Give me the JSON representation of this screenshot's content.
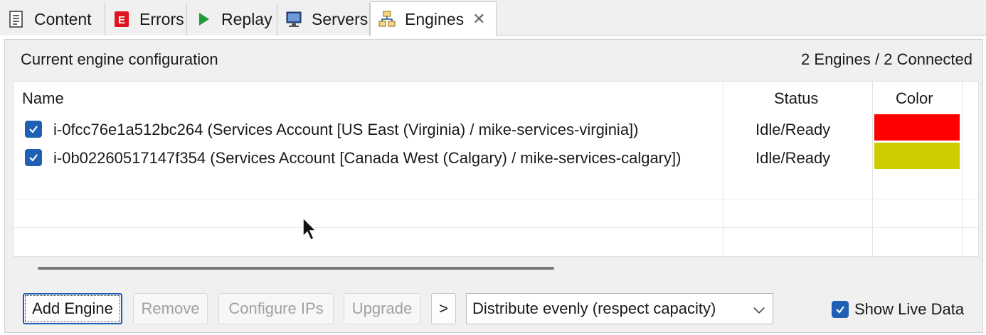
{
  "tabs": [
    {
      "label": "Content",
      "icon": "document-icon"
    },
    {
      "label": "Errors",
      "icon": "error-icon"
    },
    {
      "label": "Replay",
      "icon": "play-icon"
    },
    {
      "label": "Servers",
      "icon": "monitor-icon"
    },
    {
      "label": "Engines",
      "icon": "engines-icon",
      "active": true
    }
  ],
  "panel": {
    "title": "Current engine configuration",
    "summary": "2 Engines / 2 Connected"
  },
  "table": {
    "columns": [
      "Name",
      "Status",
      "Color"
    ],
    "rows": [
      {
        "checked": true,
        "name": "i-0fcc76e1a512bc264 (Services Account [US East (Virginia) / mike-services-virginia])",
        "status": "Idle/Ready",
        "color": "#ff0000"
      },
      {
        "checked": true,
        "name": "i-0b02260517147f354 (Services Account [Canada West (Calgary) / mike-services-calgary])",
        "status": "Idle/Ready",
        "color": "#cccc00"
      }
    ]
  },
  "toolbar": {
    "add_engine": "Add Engine",
    "remove": "Remove",
    "configure_ips": "Configure IPs",
    "upgrade": "Upgrade",
    "more": ">",
    "distribution": "Distribute evenly (respect capacity)",
    "show_live_data": "Show Live Data"
  },
  "colors": {
    "accent": "#1f5fb4"
  }
}
